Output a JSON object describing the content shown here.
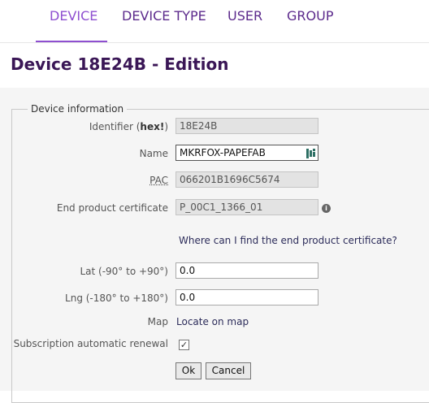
{
  "nav": {
    "tabs": [
      {
        "label": "DEVICE",
        "active": true
      },
      {
        "label": "DEVICE TYPE",
        "active": false
      },
      {
        "label": "USER",
        "active": false
      },
      {
        "label": "GROUP",
        "active": false
      }
    ]
  },
  "page": {
    "title": "Device 18E24B - Edition"
  },
  "form": {
    "legend": "Device information",
    "identifier": {
      "label_pre": "Identifier (",
      "label_bold": "hex!",
      "label_post": ")",
      "value": "18E24B"
    },
    "name": {
      "label": "Name",
      "value": "MKRFOX-PAPEFAB"
    },
    "pac": {
      "label": "PAC",
      "value": "066201B1696C5674"
    },
    "certificate": {
      "label": "End product certificate",
      "value": "P_00C1_1366_01",
      "info_icon": "info-circle-icon"
    },
    "certificate_help": "Where can I find the end product certificate?",
    "lat": {
      "label": "Lat (-90° to +90°)",
      "value": "0.0"
    },
    "lng": {
      "label": "Lng (-180° to +180°)",
      "value": "0.0"
    },
    "map": {
      "label": "Map",
      "link": "Locate on map"
    },
    "renewal": {
      "label": "Subscription automatic renewal",
      "checked": true
    },
    "ok_label": "Ok",
    "cancel_label": "Cancel"
  },
  "colors": {
    "accent": "#8e4fd0",
    "title": "#3a1656",
    "panel_bg": "#f5f5f5"
  }
}
